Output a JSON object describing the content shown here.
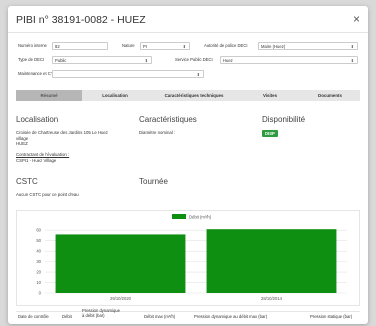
{
  "modal": {
    "title": "PIBI n° 38191-0082 - HUEZ",
    "close": "×"
  },
  "form": {
    "numero_interne_label": "Numéro interne",
    "numero_interne_value": "82",
    "nature_label": "Nature",
    "nature_value": "PI",
    "autorite_label": "Autorité de police DECI",
    "autorite_value": "Maire (Huez)",
    "type_deci_label": "Type de DECI",
    "type_deci_value": "Public",
    "service_label": "Service Public DECI",
    "service_value": "Huez",
    "maintenance_label": "Maintenance et CT*",
    "maintenance_value": ""
  },
  "tabs": [
    {
      "label": "Résumé",
      "active": true
    },
    {
      "label": "Localisation",
      "active": false
    },
    {
      "label": "Caractéristiques techniques",
      "active": false
    },
    {
      "label": "Visites",
      "active": false
    },
    {
      "label": "Documents",
      "active": false
    }
  ],
  "localisation": {
    "title": "Localisation",
    "address_lines": [
      "Croisée de Chartreuse des Jardins 105 Le Huez",
      "village",
      "HUEZ"
    ],
    "contact_label": "Contractant de l'évaluation :",
    "contact_value": "CSPI1 - Huez Village"
  },
  "caracteristiques": {
    "title": "Caractéristiques",
    "diametre": "Diamètre nominal : "
  },
  "disponibilite": {
    "title": "Disponibilité",
    "status": "DISP",
    "status_color": "#2e9b3e"
  },
  "cstc": {
    "title": "CSTC",
    "text": "Aucun CSTC pour ce point d'eau"
  },
  "tournee": {
    "title": "Tournée"
  },
  "chart_data": {
    "type": "bar",
    "categories": [
      "29/10/2020",
      "28/10/2014"
    ],
    "series": [
      {
        "name": "Débit (m³/h)",
        "values": [
          56,
          61
        ],
        "color": "#0f8f12"
      }
    ],
    "yticks": [
      0,
      10,
      20,
      30,
      40,
      50,
      60
    ],
    "ylim": [
      0,
      65
    ],
    "legend": "top-center",
    "grid": true
  },
  "footer": {
    "columns": [
      "Date de contrôle",
      "Débit",
      "Pression dynamique à débit (bar)",
      "Débit max (m³/h)",
      "Pression dynamique au débit max (bar)",
      "Pression statique (bar)"
    ]
  }
}
